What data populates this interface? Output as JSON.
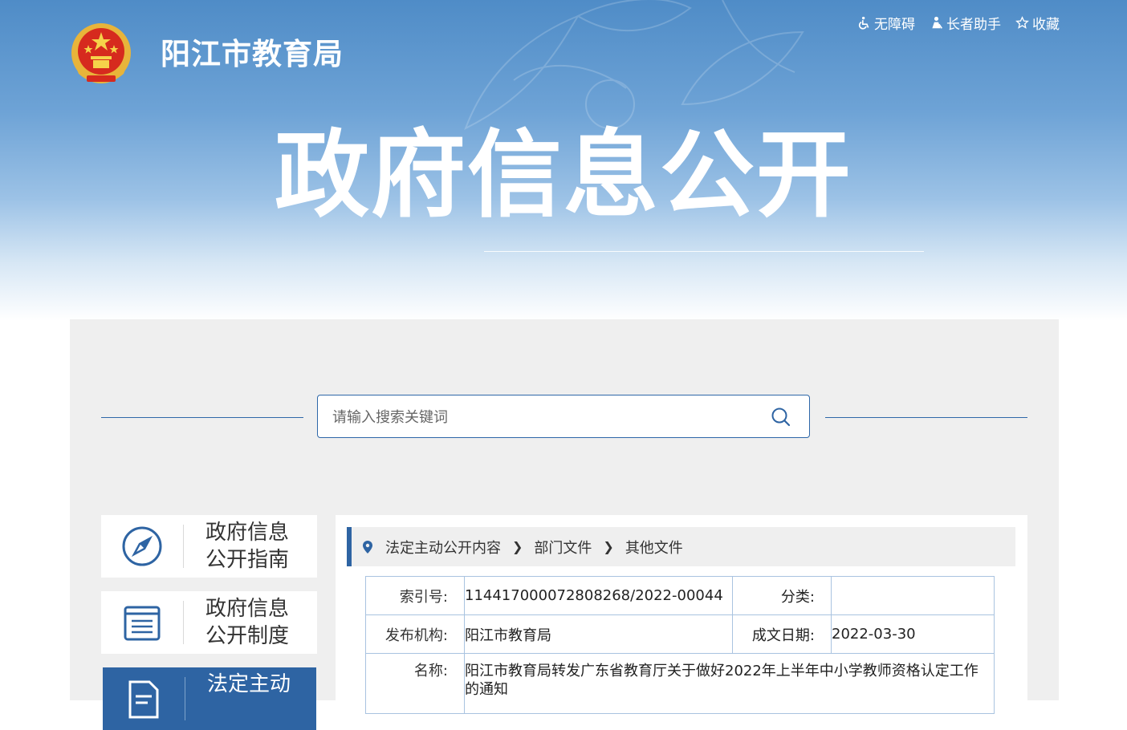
{
  "header": {
    "site_title": "阳江市教育局",
    "hero_title": "政府信息公开",
    "top_links": [
      {
        "label": "无障碍",
        "icon": "wheelchair-icon"
      },
      {
        "label": "长者助手",
        "icon": "elder-helper-icon"
      },
      {
        "label": "收藏",
        "icon": "star-icon"
      }
    ]
  },
  "search": {
    "placeholder": "请输入搜索关键词",
    "icon": "search-icon"
  },
  "sidebar": {
    "items": [
      {
        "line1": "政府信息",
        "line2": "公开指南",
        "icon": "compass-icon"
      },
      {
        "line1": "政府信息",
        "line2": "公开制度",
        "icon": "list-document-icon"
      },
      {
        "line1": "法定主动",
        "line2": "",
        "icon": "document-icon"
      }
    ]
  },
  "breadcrumb": {
    "icon": "location-pin-icon",
    "items": [
      "法定主动公开内容",
      "部门文件",
      "其他文件"
    ]
  },
  "meta": {
    "index_label": "索引号:",
    "index_value": "114417000072808268/2022-00044",
    "category_label": "分类:",
    "category_value": "",
    "publisher_label": "发布机构:",
    "publisher_value": "阳江市教育局",
    "date_label": "成文日期:",
    "date_value": "2022-03-30",
    "name_label": "名称:",
    "name_value": "阳江市教育局转发广东省教育厅关于做好2022年上半年中小学教师资格认定工作的通知"
  },
  "colors": {
    "primary": "#2e64a3",
    "banner_top": "#4f8cc7",
    "content_bg": "#efefef",
    "table_border": "#a9c3e0"
  }
}
